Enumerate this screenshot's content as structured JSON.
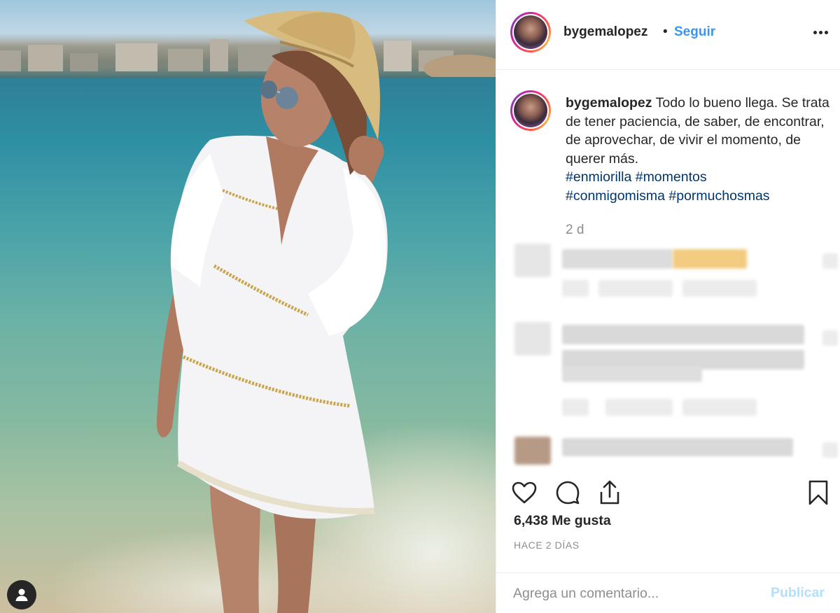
{
  "post": {
    "username": "bygemalopez",
    "dot": "•",
    "follow_label": "Seguir",
    "caption_text": "Todo lo bueno llega. Se trata de tener paciencia, de saber, de encontrar, de aprovechar, de vivir el momento, de querer más.",
    "hashtags": [
      "#enmiorilla",
      "#momentos",
      "#conmigomisma",
      "#pormuchosmas"
    ],
    "age": "2 d",
    "likes": "6,438 Me gusta",
    "time_ago": "HACE 2 DÍAS"
  },
  "comment_box": {
    "placeholder": "Agrega un comentario...",
    "publish_label": "Publicar"
  },
  "icons": {
    "more": "more-options-icon",
    "like": "heart-icon",
    "comment": "comment-bubble-icon",
    "share": "share-icon",
    "save": "bookmark-icon",
    "user": "user-icon"
  },
  "colors": {
    "link": "#3897f0",
    "hashtag": "#003569",
    "muted": "#8e8e8e",
    "publish_disabled": "#b2dffc"
  }
}
